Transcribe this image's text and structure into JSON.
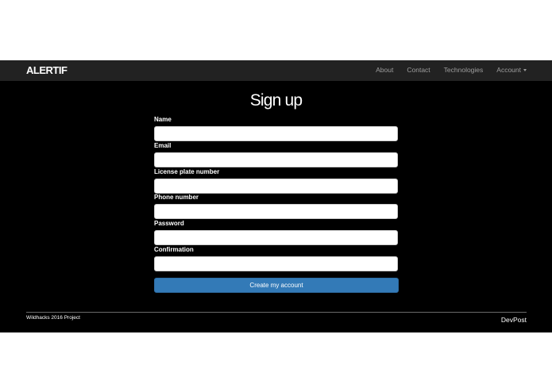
{
  "navbar": {
    "brand": "ALERTIF",
    "links": [
      {
        "label": "About"
      },
      {
        "label": "Contact"
      },
      {
        "label": "Technologies"
      },
      {
        "label": "Account"
      }
    ]
  },
  "form": {
    "title": "Sign up",
    "fields": [
      {
        "label": "Name",
        "value": ""
      },
      {
        "label": "Email",
        "value": ""
      },
      {
        "label": "License plate number",
        "value": ""
      },
      {
        "label": "Phone number",
        "value": ""
      },
      {
        "label": "Password",
        "value": ""
      },
      {
        "label": "Confirmation",
        "value": ""
      }
    ],
    "submit_label": "Create my account"
  },
  "footer": {
    "left_text": "Wildhacks 2016 Project",
    "right_link": "DevPost"
  },
  "colors": {
    "navbar_bg": "#222222",
    "content_bg": "#000000",
    "button_bg": "#337ab7"
  }
}
